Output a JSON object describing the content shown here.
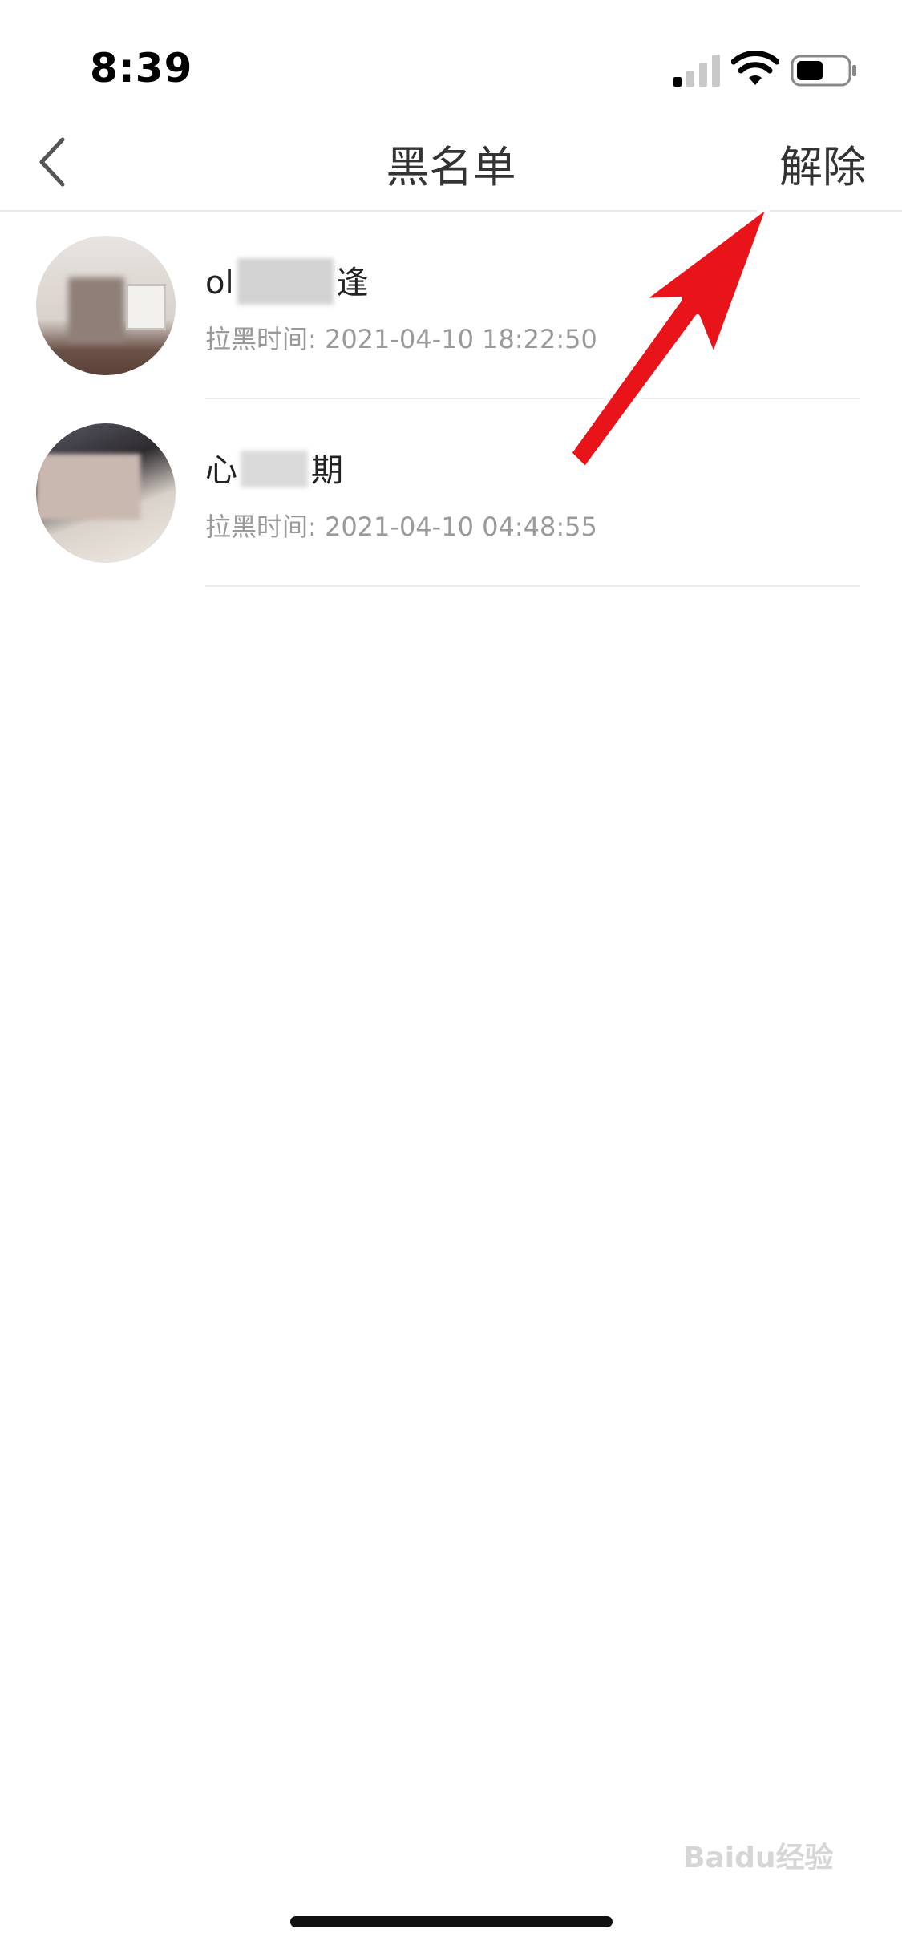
{
  "status_bar": {
    "time": "8:39",
    "icons": [
      "signal-icon",
      "wifi-icon",
      "battery-icon"
    ]
  },
  "nav": {
    "back_icon": "chevron-left-icon",
    "title": "黑名单",
    "action_label": "解除"
  },
  "list": {
    "items": [
      {
        "name_prefix": "ol",
        "name_suffix": "逢",
        "time_label": "拉黑时间: 2021-04-10 18:22:50"
      },
      {
        "name_prefix": "心",
        "name_suffix": "期",
        "time_label": "拉黑时间: 2021-04-10 04:48:55"
      }
    ]
  },
  "watermark": "Baidu经验",
  "colors": {
    "arrow": "#e8141a",
    "divider": "#ececec",
    "secondary_text": "#9a9a9a"
  }
}
